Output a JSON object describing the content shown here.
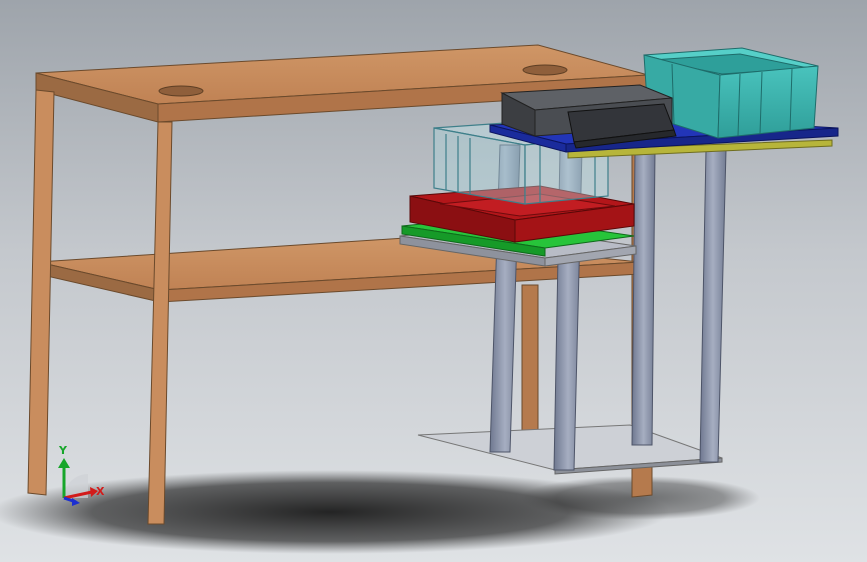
{
  "viewport": {
    "background_top": "#9ea4ab",
    "background_bottom": "#dfe2e5"
  },
  "model": {
    "parts": [
      "wooden-table",
      "metal-stand",
      "clear-storage-box",
      "red-tray",
      "green-board",
      "gray-base-plate",
      "blue-top-plate",
      "yellow-plate",
      "dark-gray-device",
      "teal-bin"
    ],
    "colors": {
      "wood": "#c98d5e",
      "wood_dark": "#9b6a43",
      "steel": "#8a93a8",
      "blue_plate": "#1c2fa6",
      "yellow_plate": "#b7b53a",
      "red_tray": "#a31212",
      "green_board": "#18b82f",
      "teal_bin": "#3fb7b1",
      "device": "#4a4d52"
    }
  },
  "triad": {
    "x_label": "X",
    "y_label": "Y",
    "x_color": "#d21b1b",
    "y_color": "#17a62a",
    "z_color": "#1c2fd0"
  }
}
